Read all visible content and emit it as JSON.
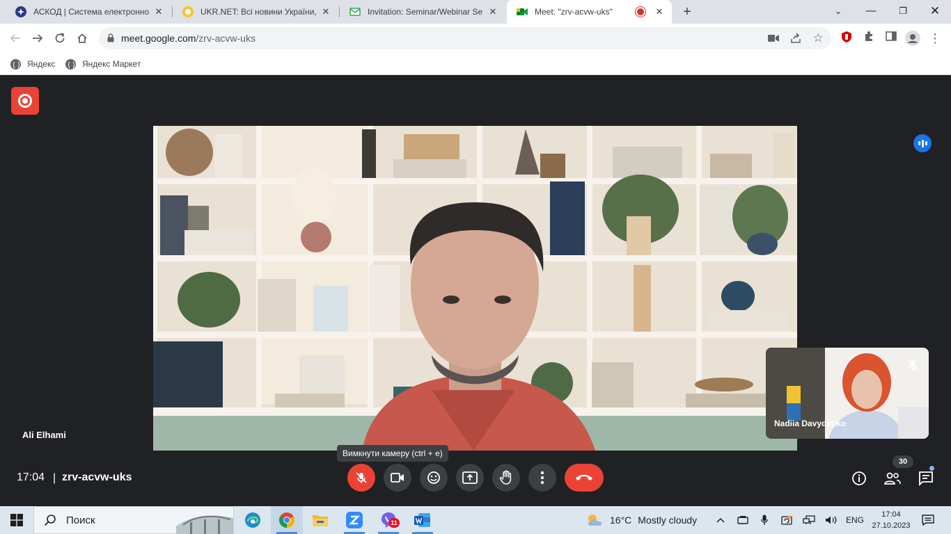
{
  "browser": {
    "tabs": [
      {
        "title": "АСКОД | Система електронного",
        "icon": "askod-icon"
      },
      {
        "title": "UKR.NET: Всі новини України, о",
        "icon": "ukrnet-icon"
      },
      {
        "title": "Invitation: Seminar/Webinar Ser",
        "icon": "gmail-icon"
      },
      {
        "title": "Meet: \"zrv-acvw-uks\"",
        "icon": "meet-icon",
        "active": true,
        "recording": true
      }
    ],
    "url_host": "meet.google.com",
    "url_path": "/zrv-acvw-uks",
    "bookmarks": [
      "Яндекс",
      "Яндекс Маркет"
    ]
  },
  "meet": {
    "main_speaker": "Ali Elhami",
    "self_name": "Nadiia Davydenko",
    "time": "17:04",
    "divider": "|",
    "meeting_code": "zrv-acvw-uks",
    "tooltip": "Вимкнути камеру (ctrl + e)",
    "participants_count": "30",
    "controls": [
      "mic-off",
      "camera",
      "emoji",
      "present",
      "raise-hand",
      "more",
      "leave"
    ],
    "colors": {
      "red": "#ea4335",
      "button": "#3c4043",
      "background": "#202124",
      "accent": "#1a73e8"
    }
  },
  "taskbar": {
    "search_placeholder": "Поиск",
    "viber_badge": "11",
    "weather_temp": "16°C",
    "weather_text": "Mostly cloudy",
    "language": "ENG",
    "time": "17:04",
    "date": "27.10.2023"
  }
}
